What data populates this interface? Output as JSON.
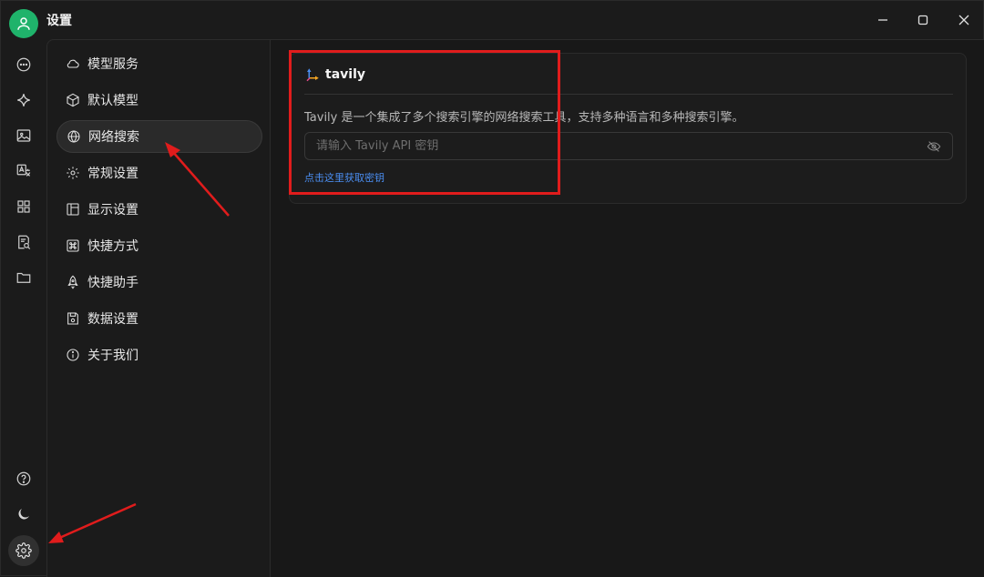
{
  "window": {
    "title": "设置",
    "controls": [
      "minimize",
      "maximize",
      "close"
    ]
  },
  "rail": {
    "items": [
      {
        "icon": "chat-icon"
      },
      {
        "icon": "sparkle-icon"
      },
      {
        "icon": "image-icon"
      },
      {
        "icon": "translate-icon"
      },
      {
        "icon": "apps-icon"
      },
      {
        "icon": "doc-search-icon"
      },
      {
        "icon": "folder-icon"
      }
    ],
    "bottom": [
      {
        "icon": "help-icon"
      },
      {
        "icon": "moon-icon"
      },
      {
        "icon": "gear-icon",
        "active": true
      }
    ]
  },
  "nav": {
    "items": [
      {
        "label": "模型服务",
        "icon": "cloud-icon"
      },
      {
        "label": "默认模型",
        "icon": "cube-icon"
      },
      {
        "label": "网络搜索",
        "icon": "globe-icon",
        "active": true
      },
      {
        "label": "常规设置",
        "icon": "gear-icon"
      },
      {
        "label": "显示设置",
        "icon": "layout-icon"
      },
      {
        "label": "快捷方式",
        "icon": "command-icon"
      },
      {
        "label": "快捷助手",
        "icon": "rocket-icon"
      },
      {
        "label": "数据设置",
        "icon": "save-icon"
      },
      {
        "label": "关于我们",
        "icon": "info-icon"
      }
    ]
  },
  "main": {
    "provider_name": "tavily",
    "description": "Tavily 是一个集成了多个搜索引擎的网络搜索工具，支持多种语言和多种搜索引擎。",
    "api_key": {
      "value": "",
      "placeholder": "请输入 Tavily API 密钥"
    },
    "get_key_link": "点击这里获取密钥"
  },
  "colors": {
    "accent_green": "#1fb36b",
    "annotation_red": "#e01c1c",
    "link_blue": "#4a8df0"
  }
}
